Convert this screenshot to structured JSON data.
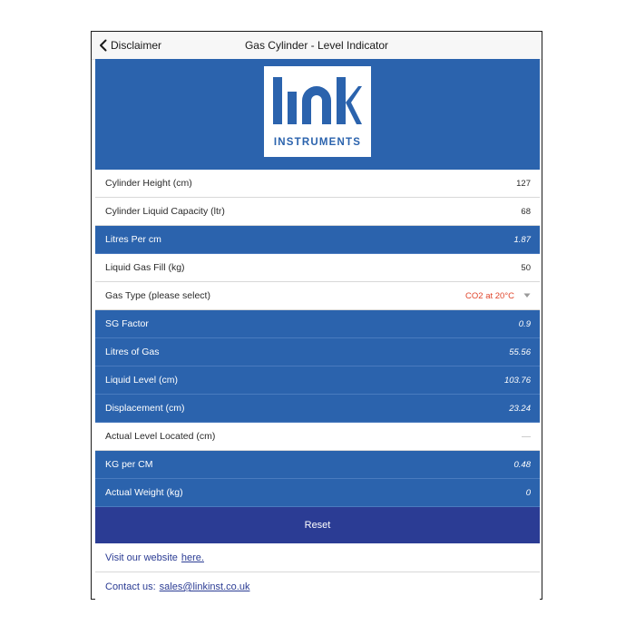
{
  "nav": {
    "back_label": "Disclaimer",
    "title": "Gas Cylinder - Level Indicator"
  },
  "logo": {
    "wordmark": "INSTRUMENTS",
    "brand_color": "#2b63ad"
  },
  "rows": [
    {
      "label": "Cylinder Height (cm)",
      "value": "127"
    },
    {
      "label": "Cylinder Liquid Capacity (ltr)",
      "value": "68"
    },
    {
      "label": "Litres Per cm",
      "value": "1.87"
    },
    {
      "label": "Liquid Gas Fill (kg)",
      "value": "50"
    },
    {
      "label": "Gas Type (please select)",
      "value": "CO2 at 20°C"
    },
    {
      "label": "SG Factor",
      "value": "0.9"
    },
    {
      "label": "Litres of Gas",
      "value": "55.56"
    },
    {
      "label": "Liquid Level (cm)",
      "value": "103.76"
    },
    {
      "label": "Displacement (cm)",
      "value": "23.24"
    },
    {
      "label": "Actual Level Located (cm)",
      "value": "—"
    },
    {
      "label": "KG per CM",
      "value": "0.48"
    },
    {
      "label": "Actual Weight (kg)",
      "value": "0"
    }
  ],
  "reset_label": "Reset",
  "footer": {
    "website_text": "Visit our website",
    "website_link": "here.",
    "contact_text": "Contact us:",
    "contact_link": "sales@linkinst.co.uk"
  },
  "colors": {
    "accent": "#2b63ad",
    "button": "#2b3c94",
    "select_value": "#e0452b"
  }
}
